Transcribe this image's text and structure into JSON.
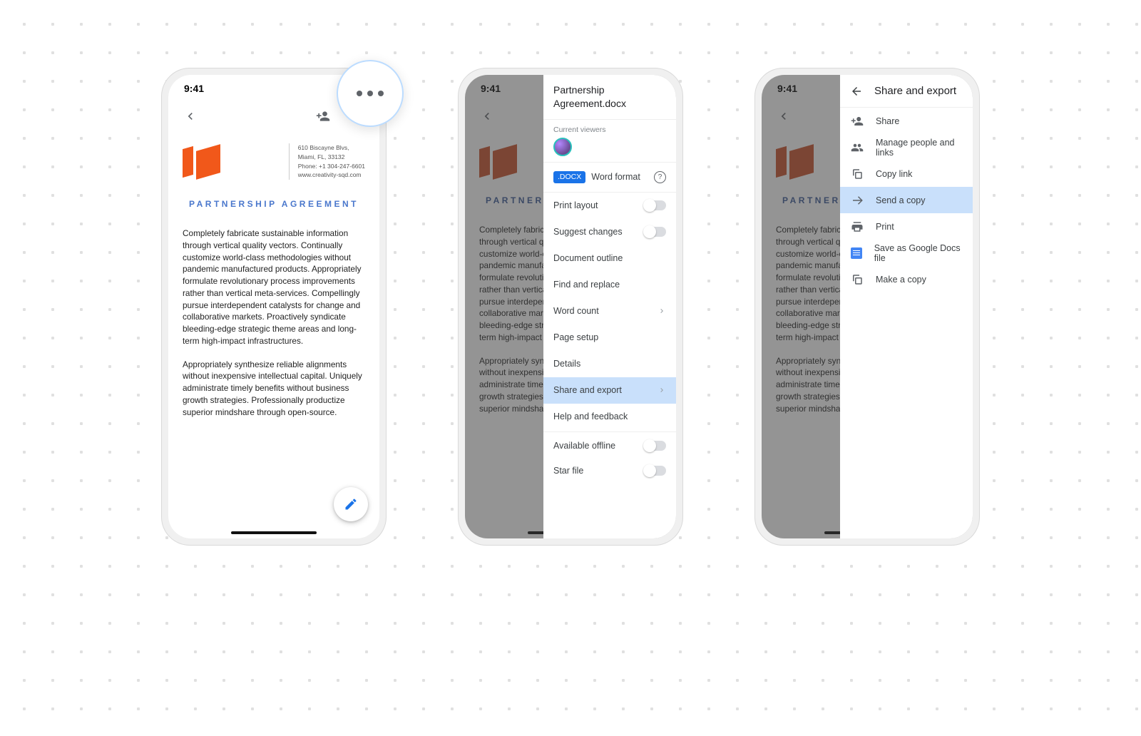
{
  "status": {
    "time": "9:41"
  },
  "doc": {
    "addr_line1": "610 Biscayne Blvs,",
    "addr_line2": "Miami, FL, 33132",
    "addr_line3": "Phone: +1 304-247-6601",
    "addr_line4": "www.creativity-sqd.com",
    "title": "PARTNERSHIP AGREEMENT",
    "para1": "Completely fabricate sustainable information through vertical quality vectors. Continually customize world-class methodologies without pandemic manufactured products. Appropriately formulate revolutionary process improvements rather than vertical meta-services. Compellingly pursue interdependent catalysts for change and collaborative markets. Proactively syndicate bleeding-edge strategic theme areas and long-term high-impact infrastructures.",
    "para2": "Appropriately synthesize reliable alignments without inexpensive intellectual capital. Uniquely administrate timely benefits without business growth strategies. Professionally productize superior mindshare through open-source."
  },
  "overflow": {
    "file_name": "Partnership Agreement.docx",
    "viewers_label": "Current viewers",
    "docx_badge": ".DOCX",
    "word_format": "Word format",
    "items": {
      "print_layout": "Print layout",
      "suggest_changes": "Suggest changes",
      "doc_outline": "Document outline",
      "find_replace": "Find and replace",
      "word_count": "Word count",
      "page_setup": "Page setup",
      "details": "Details",
      "share_export": "Share and export",
      "help_feedback": "Help and feedback",
      "available_offline": "Available offline",
      "star_file": "Star file"
    }
  },
  "share": {
    "title": "Share and export",
    "items": {
      "share": "Share",
      "manage": "Manage people and links",
      "copy_link": "Copy link",
      "send_copy": "Send a copy",
      "print": "Print",
      "save_gdocs": "Save as Google Docs file",
      "make_copy": "Make a copy"
    }
  }
}
